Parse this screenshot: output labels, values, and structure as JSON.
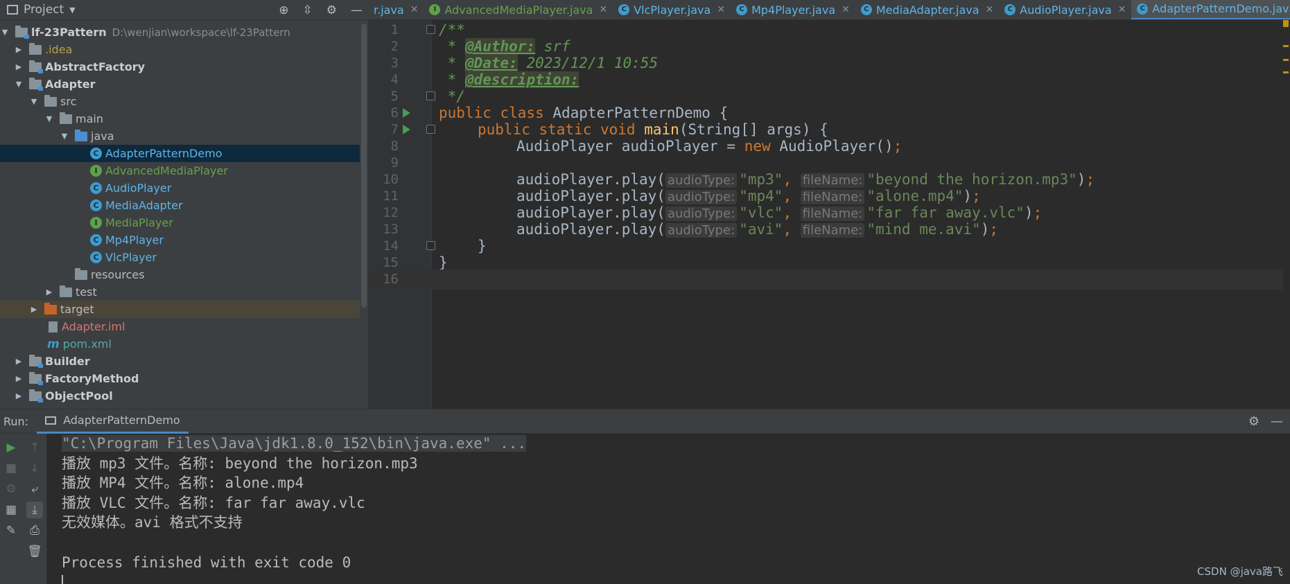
{
  "project_panel": {
    "title": "Project",
    "tree": [
      {
        "label": "lf-23Pattern",
        "hint": "D:\\wenjian\\workspace\\lf-23Pattern"
      },
      {
        "label": ".idea"
      },
      {
        "label": "AbstractFactory"
      },
      {
        "label": "Adapter"
      },
      {
        "label": "src"
      },
      {
        "label": "main"
      },
      {
        "label": "java"
      },
      {
        "label": "AdapterPatternDemo"
      },
      {
        "label": "AdvancedMediaPlayer"
      },
      {
        "label": "AudioPlayer"
      },
      {
        "label": "MediaAdapter"
      },
      {
        "label": "MediaPlayer"
      },
      {
        "label": "Mp4Player"
      },
      {
        "label": "VlcPlayer"
      },
      {
        "label": "resources"
      },
      {
        "label": "test"
      },
      {
        "label": "target"
      },
      {
        "label": "Adapter.iml"
      },
      {
        "label": "pom.xml"
      },
      {
        "label": "Builder"
      },
      {
        "label": "FactoryMethod"
      },
      {
        "label": "ObjectPool"
      }
    ]
  },
  "tabs": [
    {
      "label": "r.java",
      "icon": "none"
    },
    {
      "label": "AdvancedMediaPlayer.java",
      "icon": "interface"
    },
    {
      "label": "VlcPlayer.java",
      "icon": "class"
    },
    {
      "label": "Mp4Player.java",
      "icon": "class"
    },
    {
      "label": "MediaAdapter.java",
      "icon": "class"
    },
    {
      "label": "AudioPlayer.java",
      "icon": "class"
    },
    {
      "label": "AdapterPatternDemo.java",
      "icon": "class",
      "active": true
    }
  ],
  "editor": {
    "line_numbers": [
      "1",
      "2",
      "3",
      "4",
      "5",
      "6",
      "7",
      "8",
      "9",
      "10",
      "11",
      "12",
      "13",
      "14",
      "15",
      "16"
    ],
    "comment_open": "/**",
    "author_tag": "@Author:",
    "author_value": " srf",
    "date_tag": "@Date:",
    "date_value": " 2023/12/1 10:55",
    "desc_tag": "@description:",
    "comment_close": " */",
    "class_keywords": "public class",
    "class_name": " AdapterPatternDemo {",
    "main_keywords": "public static void",
    "main_name": "main",
    "main_params": "(String[] args) {",
    "decl_type": "AudioPlayer audioPlayer = ",
    "decl_new": "new",
    "decl_ctor": " AudioPlayer()",
    "semicolon": ";",
    "call_prefix": "audioPlayer.play(",
    "hint_audio_type": "audioType:",
    "hint_file_name": "fileName:",
    "calls": [
      {
        "type": "\"mp3\"",
        "file": "\"beyond the horizon.mp3\""
      },
      {
        "type": "\"mp4\"",
        "file": "\"alone.mp4\""
      },
      {
        "type": "\"vlc\"",
        "file": "\"far far away.vlc\""
      },
      {
        "type": "\"avi\"",
        "file": "\"mind me.avi\""
      }
    ],
    "comma": ", ",
    "call_close": ")",
    "brace_close": "}"
  },
  "run_panel": {
    "label": "Run:",
    "tab": "AdapterPatternDemo",
    "console_lines": [
      "\"C:\\Program Files\\Java\\jdk1.8.0_152\\bin\\java.exe\" ...",
      "播放 mp3 文件。名称: beyond the horizon.mp3",
      "播放 MP4 文件。名称: alone.mp4",
      "播放 VLC 文件。名称: far far away.vlc",
      "无效媒体。avi 格式不支持",
      "",
      "Process finished with exit code 0"
    ]
  },
  "watermark": "CSDN @java路飞",
  "colors": {
    "keyword": "#cc7832",
    "string": "#6a8759",
    "method": "#ffc66d",
    "comment": "#629755",
    "accent": "#4a88c7"
  }
}
